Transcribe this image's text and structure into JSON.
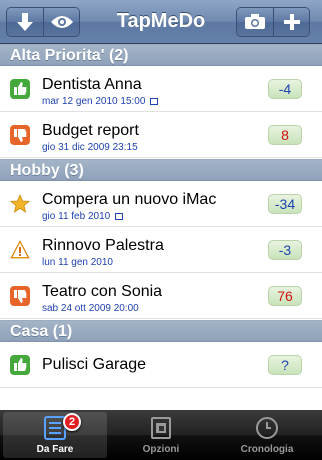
{
  "app": {
    "title": "TapMeDo"
  },
  "navbar": {
    "left_icons": [
      "down-arrow-icon",
      "eye-icon"
    ],
    "right_icons": [
      "camera-icon",
      "plus-icon"
    ]
  },
  "sections": [
    {
      "header": "Alta Priorita' (2)",
      "rows": [
        {
          "icon": "thumbs-up-icon",
          "title": "Dentista Anna",
          "date": "mar 12 gen 2010  15:00",
          "has_note": true,
          "badge": "-4",
          "badge_color": "blue"
        },
        {
          "icon": "thumbs-down-icon",
          "title": "Budget report",
          "date": "gio 31 dic 2009  23:15",
          "has_note": false,
          "badge": "8",
          "badge_color": "red"
        }
      ]
    },
    {
      "header": "Hobby (3)",
      "rows": [
        {
          "icon": "star-icon",
          "title": "Compera un nuovo iMac",
          "date": "gio 11 feb 2010",
          "has_note": true,
          "badge": "-34",
          "badge_color": "blue"
        },
        {
          "icon": "warning-icon",
          "title": "Rinnovo Palestra",
          "date": "lun 11 gen 2010",
          "has_note": false,
          "badge": "-3",
          "badge_color": "blue"
        },
        {
          "icon": "thumbs-down-icon",
          "title": "Teatro con Sonia",
          "date": "sab 24 ott 2009  20:00",
          "has_note": false,
          "badge": "76",
          "badge_color": "red"
        }
      ]
    },
    {
      "header": "Casa (1)",
      "rows": [
        {
          "icon": "thumbs-up-icon",
          "title": "Pulisci Garage",
          "date": "",
          "has_note": false,
          "badge": "?",
          "badge_color": "blue"
        }
      ]
    }
  ],
  "tabbar": {
    "tabs": [
      {
        "label": "Da Fare",
        "icon": "list-icon",
        "badge": "2",
        "active": true
      },
      {
        "label": "Opzioni",
        "icon": "options-icon",
        "active": false
      },
      {
        "label": "Cronologia",
        "icon": "clock-icon",
        "active": false
      }
    ]
  },
  "colors": {
    "navbar": "#6f89b0",
    "section_header": "#98aac0",
    "date_text": "#1f43b0",
    "badge_red": "#d01010",
    "badge_bg": "#d6ebc9"
  }
}
